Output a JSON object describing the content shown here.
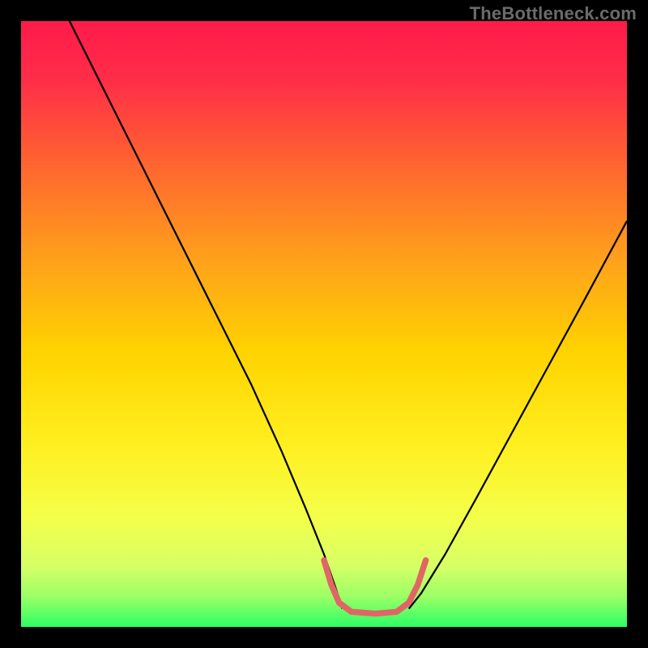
{
  "watermark": "TheBottleneck.com",
  "chart_data": {
    "type": "line",
    "title": "",
    "xlabel": "",
    "ylabel": "",
    "xlim": [
      0,
      1000
    ],
    "ylim": [
      0,
      1000
    ],
    "gradient_stops": [
      {
        "offset": 0.0,
        "color": "#ff1a4b"
      },
      {
        "offset": 0.1,
        "color": "#ff2e47"
      },
      {
        "offset": 0.25,
        "color": "#ff6a2e"
      },
      {
        "offset": 0.4,
        "color": "#ffa31a"
      },
      {
        "offset": 0.55,
        "color": "#ffd400"
      },
      {
        "offset": 0.7,
        "color": "#ffef20"
      },
      {
        "offset": 0.82,
        "color": "#f4ff4a"
      },
      {
        "offset": 0.9,
        "color": "#d6ff66"
      },
      {
        "offset": 0.95,
        "color": "#9cff66"
      },
      {
        "offset": 1.0,
        "color": "#2cff66"
      }
    ],
    "series": [
      {
        "name": "curve-left",
        "stroke": "#000000",
        "width": 3,
        "points": [
          {
            "x": 80,
            "y": 1000
          },
          {
            "x": 140,
            "y": 880
          },
          {
            "x": 200,
            "y": 760
          },
          {
            "x": 260,
            "y": 640
          },
          {
            "x": 320,
            "y": 520
          },
          {
            "x": 380,
            "y": 400
          },
          {
            "x": 430,
            "y": 290
          },
          {
            "x": 470,
            "y": 195
          },
          {
            "x": 500,
            "y": 120
          },
          {
            "x": 520,
            "y": 62
          },
          {
            "x": 530,
            "y": 30
          }
        ]
      },
      {
        "name": "curve-right",
        "stroke": "#000000",
        "width": 3,
        "points": [
          {
            "x": 640,
            "y": 30
          },
          {
            "x": 660,
            "y": 55
          },
          {
            "x": 700,
            "y": 120
          },
          {
            "x": 750,
            "y": 210
          },
          {
            "x": 810,
            "y": 320
          },
          {
            "x": 870,
            "y": 430
          },
          {
            "x": 930,
            "y": 540
          },
          {
            "x": 1000,
            "y": 670
          }
        ]
      },
      {
        "name": "floor-highlight",
        "stroke": "#e06666",
        "width": 10,
        "linecap": "round",
        "points": [
          {
            "x": 500,
            "y": 110
          },
          {
            "x": 512,
            "y": 70
          },
          {
            "x": 525,
            "y": 40
          },
          {
            "x": 545,
            "y": 25
          },
          {
            "x": 585,
            "y": 22
          },
          {
            "x": 620,
            "y": 25
          },
          {
            "x": 640,
            "y": 40
          },
          {
            "x": 655,
            "y": 70
          },
          {
            "x": 668,
            "y": 110
          }
        ]
      }
    ]
  }
}
